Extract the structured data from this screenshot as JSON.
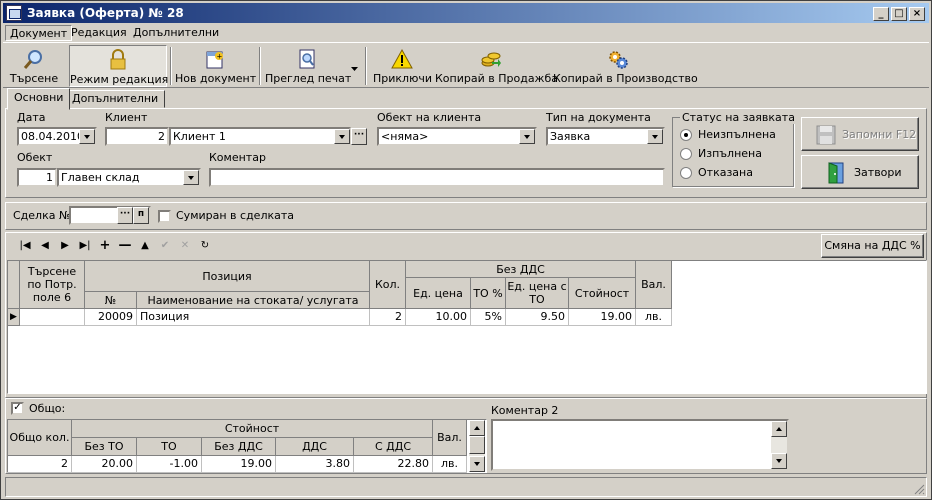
{
  "window": {
    "title": "Заявка (Оферта) № 28"
  },
  "menu": [
    "Документ",
    "Редакция",
    "Допълнителни"
  ],
  "toolbar": {
    "search": "Търсене",
    "edit_mode": "Режим редакция",
    "new_doc": "Нов документ",
    "print_preview": "Преглед печат",
    "finish": "Приключи",
    "copy_sales": "Копирай в Продажба",
    "copy_production": "Копирай в Производство"
  },
  "tabs": [
    "Основни",
    "Допълнителни"
  ],
  "form": {
    "date_label": "Дата",
    "date_value": "08.04.2010",
    "client_label": "Клиент",
    "client_id": "2",
    "client_name": "Клиент 1",
    "client_object_label": "Обект на клиента",
    "client_object_value": "<няма>",
    "doc_type_label": "Тип на документа",
    "doc_type_value": "Заявка",
    "object_label": "Обект",
    "object_id": "1",
    "object_name": "Главен склад",
    "comment_label": "Коментар",
    "comment_value": ""
  },
  "status": {
    "title": "Статус на заявката",
    "options": [
      "Неизпълнена",
      "Изпълнена",
      "Отказана"
    ],
    "selected": 0
  },
  "buttons": {
    "save": "Запомни  F12",
    "close": "Затвори",
    "vat_change": "Смяна на ДДС %"
  },
  "deal": {
    "label": "Сделка №",
    "value": "",
    "summed_label": "Сумиран в сделката"
  },
  "grid": {
    "headers": {
      "search_by": "Търсене по Потр. поле 6",
      "position": "Позиция",
      "number": "№",
      "item_name": "Наименование на стоката/ услугата",
      "qty": "Кол.",
      "no_vat": "Без ДДС",
      "unit_price": "Ед. цена",
      "to_pct": "ТО %",
      "unit_price_to": "Ед. цена с ТО",
      "value": "Стойност",
      "currency": "Вал."
    },
    "rows": [
      {
        "search": "",
        "number": "20009",
        "name": "Позиция",
        "qty": "2",
        "unit_price": "10.00",
        "to_pct": "5%",
        "unit_price_to": "9.50",
        "value": "19.00",
        "currency": "лв."
      }
    ]
  },
  "totals": {
    "check_label": "Общо:",
    "headers": {
      "total_qty": "Общо кол.",
      "value": "Стойност",
      "no_to": "Без ТО",
      "to": "ТО",
      "no_vat": "Без ДДС",
      "vat": "ДДС",
      "with_vat": "С ДДС",
      "currency": "Вал."
    },
    "row": {
      "qty": "2",
      "no_to": "20.00",
      "to": "-1.00",
      "no_vat": "19.00",
      "vat": "3.80",
      "with_vat": "22.80",
      "currency": "лв."
    }
  },
  "comment2": {
    "label": "Коментар 2",
    "value": ""
  }
}
